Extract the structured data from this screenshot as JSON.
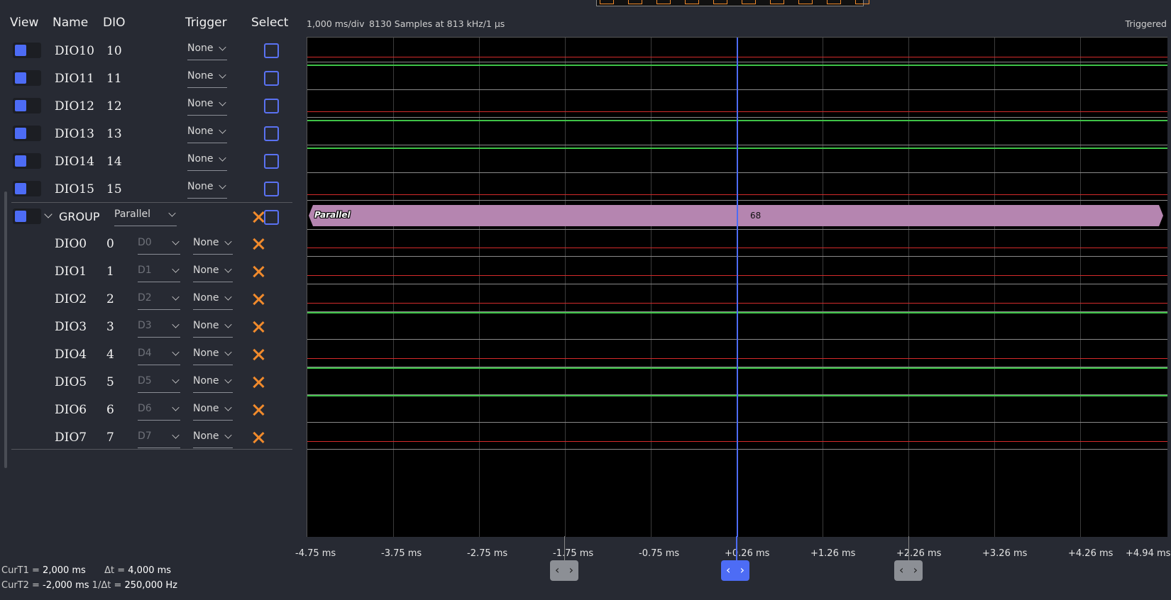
{
  "header": {
    "view": "View",
    "name": "Name",
    "dio": "DIO",
    "trigger": "Trigger",
    "select": "Select"
  },
  "plot_info": {
    "timebase": "1,000 ms/div",
    "samples": "8130 Samples at 813 kHz/1 µs",
    "status": "Triggered"
  },
  "channels": [
    {
      "name": "DIO10",
      "num": "10",
      "trigger": "None"
    },
    {
      "name": "DIO11",
      "num": "11",
      "trigger": "None"
    },
    {
      "name": "DIO12",
      "num": "12",
      "trigger": "None"
    },
    {
      "name": "DIO13",
      "num": "13",
      "trigger": "None"
    },
    {
      "name": "DIO14",
      "num": "14",
      "trigger": "None"
    },
    {
      "name": "DIO15",
      "num": "15",
      "trigger": "None"
    }
  ],
  "group": {
    "label": "GROUP",
    "type": "Parallel",
    "members": [
      {
        "name": "DIO0",
        "num": "0",
        "bit": "D0",
        "trigger": "None"
      },
      {
        "name": "DIO1",
        "num": "1",
        "bit": "D1",
        "trigger": "None"
      },
      {
        "name": "DIO2",
        "num": "2",
        "bit": "D2",
        "trigger": "None"
      },
      {
        "name": "DIO3",
        "num": "3",
        "bit": "D3",
        "trigger": "None"
      },
      {
        "name": "DIO4",
        "num": "4",
        "bit": "D4",
        "trigger": "None"
      },
      {
        "name": "DIO5",
        "num": "5",
        "bit": "D5",
        "trigger": "None"
      },
      {
        "name": "DIO6",
        "num": "6",
        "bit": "D6",
        "trigger": "None"
      },
      {
        "name": "DIO7",
        "num": "7",
        "bit": "D7",
        "trigger": "None"
      }
    ]
  },
  "bus": {
    "label": "Parallel",
    "value": "68"
  },
  "time_axis": [
    "-4.75 ms",
    "-3.75 ms",
    "-2.75 ms",
    "-1.75 ms",
    "-0.75 ms",
    "+0.26 ms",
    "+1.26 ms",
    "+2.26 ms",
    "+3.26 ms",
    "+4.26 ms",
    "+4.94 ms"
  ],
  "cursors": {
    "curt1_label": "CurT1 =",
    "curt1_value": "2,000 ms",
    "dt_label": "Δt =",
    "dt_value": "4,000 ms",
    "curt2_label": "CurT2 =",
    "curt2_value": "-2,000 ms",
    "inv_dt_label": "1/Δt =",
    "inv_dt_value": "250,000 Hz",
    "nav_glyph": "‹ ›"
  },
  "colors": {
    "accent": "#4d6cf5",
    "close": "#f08a2c",
    "bus": "#b585b0",
    "signal_low": "#d42b2b",
    "signal_high": "#3ec247"
  }
}
